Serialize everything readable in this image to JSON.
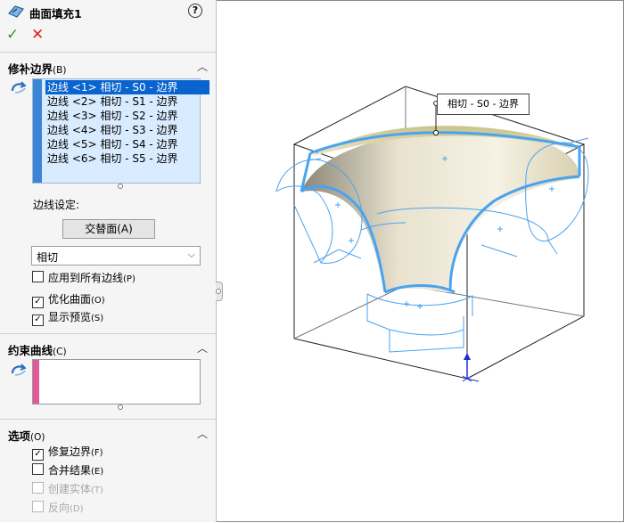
{
  "header": {
    "title": "曲面填充1",
    "help": "?",
    "ok": "✓",
    "cancel": "✕"
  },
  "patch_boundary": {
    "heading": "修补边界",
    "shortcut": "(B)",
    "items": [
      "边线 <1> 相切 - S0 - 边界",
      "边线 <2> 相切 - S1 - 边界",
      "边线 <3> 相切 - S2 - 边界",
      "边线 <4> 相切 - S3 - 边界",
      "边线 <5> 相切 - S4 - 边界",
      "边线 <6> 相切 - S5 - 边界"
    ],
    "edge_settings_label": "边线设定:",
    "alternate_face_button": "交替面(A)",
    "condition_value": "相切",
    "apply_all_label": "应用到所有边线",
    "apply_all_key": "(P)",
    "apply_all_checked": false,
    "optimize_label": "优化曲面",
    "optimize_key": "(O)",
    "optimize_checked": true,
    "preview_label": "显示预览",
    "preview_key": "(S)",
    "preview_checked": true
  },
  "constraint_curves": {
    "heading": "约束曲线",
    "shortcut": "(C)"
  },
  "options": {
    "heading": "选项",
    "shortcut": "(O)",
    "fix_label": "修复边界",
    "fix_key": "(F)",
    "fix_checked": true,
    "merge_label": "合并结果",
    "merge_key": "(E)",
    "merge_checked": false,
    "solid_label": "创建实体",
    "solid_key": "(T)",
    "solid_checked": false,
    "reverse_label": "反向",
    "reverse_key": "(D)",
    "reverse_checked": false
  },
  "viewport": {
    "callout": "相切 - S0 - 边界"
  },
  "colors": {
    "accent": "#0a64d0",
    "selection_bg": "#d9ebff",
    "edge_blue": "#4aa3f0",
    "constraint_strip": "#e05a9a"
  }
}
